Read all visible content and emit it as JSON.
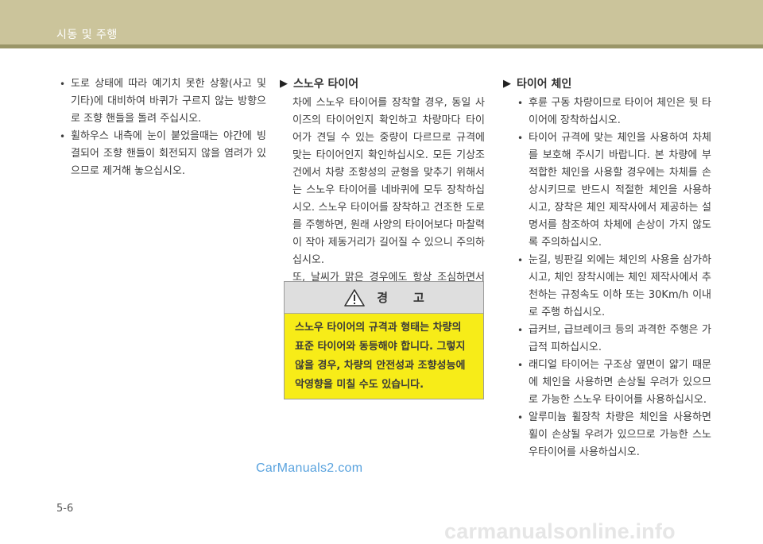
{
  "header": {
    "title": "시동 및 주행"
  },
  "col1": {
    "bullets": [
      "도로 상태에 따라 예기치 못한 상황(사고 및 기타)에 대비하여 바퀴가 구르지 않는 방향으로 조향 핸들을 돌려 주십시오.",
      "휠하우스 내측에 눈이 붙었을때는 야간에 빙결되어 조향 핸들이 회전되지 않을 염려가 있으므로 제거해 놓으십시오."
    ]
  },
  "snow_tire": {
    "heading": "스노우 타이어",
    "para1": "차에 스노우 타이어를 장착할 경우, 동일 사이즈의 타이어인지 확인하고 차량마다 타이어가 견딜 수 있는 중량이 다르므로 규격에 맞는 타이어인지 확인하십시오. 모든 기상조건에서 차량 조향성의 균형을 맞추기 위해서는 스노우 타이어를 네바퀴에 모두 장착하십시오. 스노우 타이어를 장착하고 건조한 도로를 주행하면, 원래 사양의 타이어보다 마찰력이 작아 제동거리가 길어질 수 있으니 주의하십시오.",
    "para2": "또, 날씨가 맑은 경우에도 항상 조심하면서 운전하십시오."
  },
  "warning": {
    "label": "경고",
    "body": "스노우 타이어의 규격과 형태는 차량의 표준 타이어와 동등해야 합니다. 그렇지 않을 경우, 차량의 안전성과 조향성능에 악영향을 미칠 수도 있습니다."
  },
  "tire_chain": {
    "heading": "타이어 체인",
    "bullets": [
      "후륜 구동 차량이므로 타이어 체인은 뒷 타이어에 장착하십시오.",
      "타이어 규격에 맞는 체인을 사용하여 차체를 보호해 주시기 바랍니다. 본 차량에 부적합한 체인을 사용할 경우에는 차체를 손상시키므로 반드시 적절한 체인을 사용하시고, 장착은 체인 제작사에서 제공하는 설명서를 참조하여 차체에 손상이 가지 않도록 주의하십시오.",
      "눈길, 빙판길 외에는 체인의 사용을 삼가하시고, 체인 장착시에는 체인 제작사에서 추천하는 규정속도 이하 또는 30Km/h 이내로 주행 하십시오.",
      "급커브, 급브레이크 등의 과격한 주행은 가급적 피하십시오.",
      "래디얼 타이어는 구조상 옆면이 얇기 때문에 체인을 사용하면 손상될 우려가 있으므로 가능한 스노우 타이어를 사용하십시오.",
      "알루미늄 휠장착 차량은 체인을 사용하면 휠이 손상될 우려가 있으므로 가능한 스노우타이어를 사용하십시오."
    ]
  },
  "watermark": "CarManuals2.com",
  "page_number": "5-6",
  "footer_watermark": "carmanualsonline.info",
  "icons": {
    "warning": "warning-triangle-icon",
    "section": "triangle-right-icon"
  },
  "colors": {
    "header": "#cbc49b",
    "header_rule": "#9a9668",
    "warning_bg": "#f7ec18",
    "warning_head": "#dedede"
  }
}
